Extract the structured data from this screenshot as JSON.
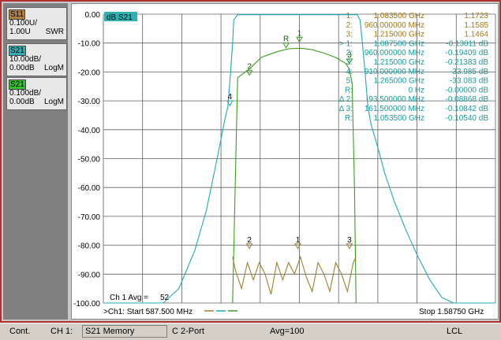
{
  "traces": [
    {
      "tag": "S11",
      "scale": "0.100U/",
      "ref": "1.00U",
      "fmt": "SWR",
      "tag_bg": "#b08040",
      "tag_fg": "#000000"
    },
    {
      "tag": "S21",
      "scale": "10.00dB/",
      "ref": "0.00dB",
      "fmt": "LogM",
      "tag_bg": "#30b0b0",
      "tag_fg": "#000000"
    },
    {
      "tag": "S21",
      "scale": "0.100dB/",
      "ref": "0.00dB",
      "fmt": "LogM",
      "tag_bg": "#30c030",
      "tag_fg": "#000000"
    }
  ],
  "plot": {
    "active_label": "dB S21",
    "avg_label": "Ch 1 Avg =",
    "avg_value": "52",
    "start_label": ">Ch1: Start  587.500 MHz",
    "stop_label": "Stop  1.58750 GHz"
  },
  "markers_table": [
    {
      "id": "1:",
      "freq": "1.083500 GHz",
      "val": "1.1723",
      "color": "#a07818"
    },
    {
      "id": "2:",
      "freq": "960.000000 MHz",
      "val": "1.1585",
      "color": "#a07818"
    },
    {
      "id": "3:",
      "freq": "1.215000 GHz",
      "val": "1.1464",
      "color": "#a07818"
    },
    {
      "id": "> 1:",
      "freq": "1.087500 GHz",
      "val": "-0.13011 dB",
      "color": "#1a9a9a"
    },
    {
      "id": "2:",
      "freq": "960.000000 MHz",
      "val": "-0.19409 dB",
      "color": "#1a9a9a"
    },
    {
      "id": "3:",
      "freq": "1.215000 GHz",
      "val": "-0.21383 dB",
      "color": "#1a9a9a"
    },
    {
      "id": "4:",
      "freq": "910.000000 MHz",
      "val": "-33.985 dB",
      "color": "#1a9a9a"
    },
    {
      "id": "5:",
      "freq": "1.265000 GHz",
      "val": "-33.083 dB",
      "color": "#1a9a9a"
    },
    {
      "id": "R:",
      "freq": "0 Hz",
      "val": "-0.00000 dB",
      "color": "#1a9a9a"
    },
    {
      "id": "Δ 2:",
      "freq": "-93.500000 MHz",
      "val": "-0.08868 dB",
      "color": "#1a9a9a"
    },
    {
      "id": "Δ 3:",
      "freq": "161.500000 MHz",
      "val": "-0.10842 dB",
      "color": "#1a9a9a"
    },
    {
      "id": "R:",
      "freq": "1.053500 GHz",
      "val": "-0.10540 dB",
      "color": "#1a9a9a"
    }
  ],
  "status": {
    "mode": "Cont.",
    "channel": "CH 1:",
    "memory": "S21 Memory",
    "cal": "C  2-Port",
    "avg": "Avg=100",
    "lcl": "LCL"
  },
  "chart_data": {
    "type": "line",
    "ylim": [
      -100,
      0
    ],
    "yticks": [
      "0.00",
      "-10.00",
      "-20.00",
      "-30.00",
      "-40.00",
      "-50.00",
      "-60.00",
      "-70.00",
      "-80.00",
      "-90.00",
      "-100.00"
    ],
    "x_start_mhz": 587.5,
    "x_stop_mhz": 1587.5,
    "grid": true,
    "series": [
      {
        "color": "#20a8b8",
        "x_mhz": [
          587.5,
          680,
          740,
          780,
          820,
          850,
          870,
          885,
          895,
          905,
          912,
          917,
          920,
          930,
          960,
          1050,
          1200,
          1235,
          1242,
          1248,
          1255,
          1262,
          1270,
          1285,
          1305,
          1330,
          1360,
          1390,
          1420,
          1450,
          1480,
          1520,
          1587.5
        ],
        "y_db": [
          -100,
          -100,
          -100,
          -95,
          -82,
          -68,
          -55,
          -45,
          -38,
          -32,
          -20,
          -10,
          -2,
          -0.2,
          -0.2,
          -0.2,
          -0.2,
          -0.2,
          -2,
          -10,
          -20,
          -32,
          -38,
          -45,
          -55,
          -65,
          -75,
          -84,
          -92,
          -98,
          -100,
          -100,
          -100
        ]
      },
      {
        "color": "#3aa020",
        "x_mhz": [
          917,
          930,
          960,
          990,
          1030,
          1060,
          1090,
          1120,
          1150,
          1180,
          1205,
          1215,
          1222,
          1228,
          1232
        ],
        "y_db": [
          -100,
          -22,
          -19,
          -15,
          -13,
          -12,
          -11.8,
          -12.3,
          -13.5,
          -15,
          -17,
          -19,
          -24,
          -60,
          -100
        ]
      },
      {
        "color": "#9a8030",
        "x_mhz": [
          917,
          925,
          940,
          955,
          970,
          985,
          1000,
          1015,
          1030,
          1045,
          1060,
          1075,
          1090,
          1105,
          1120,
          1135,
          1150,
          1165,
          1180,
          1195,
          1210,
          1225,
          1232
        ],
        "y_db": [
          -84,
          -89,
          -95,
          -86,
          -92,
          -86,
          -90,
          -97,
          -86,
          -92,
          -86,
          -90,
          -84,
          -91,
          -96,
          -86,
          -90,
          -96,
          -86,
          -90,
          -96,
          -86,
          -84
        ]
      }
    ],
    "markers": [
      {
        "label": "1",
        "x_mhz": 1087.5,
        "y_db": -8,
        "color": "#3aa020"
      },
      {
        "label": "R",
        "x_mhz": 1053.5,
        "y_db": -10,
        "color": "#3aa020"
      },
      {
        "label": "2",
        "x_mhz": 960,
        "y_db": -19.5,
        "color": "#3aa020"
      },
      {
        "label": "3",
        "x_mhz": 1215,
        "y_db": -15.5,
        "color": "#3aa020"
      },
      {
        "label": "4",
        "x_mhz": 910,
        "y_db": -30,
        "color": "#20a8b8"
      },
      {
        "label": "2",
        "x_mhz": 960,
        "y_db": -79.5,
        "color": "#9a8030"
      },
      {
        "label": "1",
        "x_mhz": 1083.5,
        "y_db": -79.5,
        "color": "#9a8030"
      },
      {
        "label": "3",
        "x_mhz": 1215,
        "y_db": -79.5,
        "color": "#9a8030"
      }
    ]
  }
}
